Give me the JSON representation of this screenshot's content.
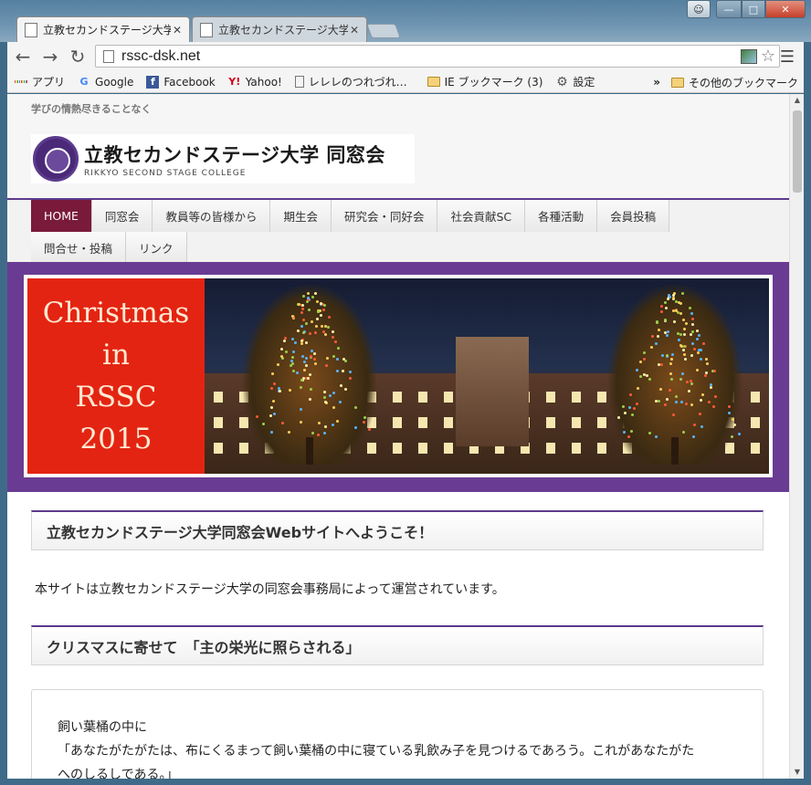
{
  "browser": {
    "tabs": [
      {
        "title": "立教セカンドステージ大学",
        "active": true
      },
      {
        "title": "立教セカンドステージ大学",
        "active": false
      }
    ],
    "url": "rssc-dsk.net",
    "bookmarks": [
      {
        "label": "アプリ",
        "icon": "apps-icon"
      },
      {
        "label": "Google",
        "icon": "google-icon"
      },
      {
        "label": "Facebook",
        "icon": "facebook-icon"
      },
      {
        "label": "Yahoo!",
        "icon": "yahoo-icon"
      },
      {
        "label": "レレレのつれづれ…",
        "icon": "page-icon"
      },
      {
        "label": "IE ブックマーク (3)",
        "icon": "folder-icon"
      },
      {
        "label": "設定",
        "icon": "gear-icon"
      }
    ],
    "bookmarks_overflow": "»",
    "other_bookmarks": "その他のブックマーク"
  },
  "site": {
    "tagline": "学びの情熱尽きることなく",
    "logo_title": "立教セカンドステージ大学 同窓会",
    "logo_subtitle": "RIKKYO SECOND STAGE COLLEGE",
    "nav_row1": [
      "HOME",
      "同窓会",
      "教員等の皆様から",
      "期生会",
      "研究会・同好会",
      "社会貢献SC",
      "各種活動",
      "会員投稿"
    ],
    "nav_row2": [
      "問合せ・投稿",
      "リンク"
    ],
    "active_nav": "HOME",
    "banner": {
      "line1": "Christmas",
      "line2": "in",
      "line3": "RSSC",
      "line4": "2015"
    },
    "welcome_title": "立教セカンドステージ大学同窓会Webサイトへようこそ！",
    "welcome_text": "本サイトは立教セカンドステージ大学の同窓会事務局によって運営されています。",
    "christmas_title": "クリスマスに寄せて　「主の栄光に照らされる」",
    "post_line1": "飼い葉桶の中に",
    "post_line2": "「あなたがたがたは、布にくるまって飼い葉桶の中に寝ている乳飲み子を見つけるであろう。これがあなたがた",
    "post_line3": "へのしるしである。」"
  },
  "colors": {
    "accent_purple": "#5b3a8c",
    "banner_red": "#e42412",
    "nav_active": "#7a1a3a"
  }
}
